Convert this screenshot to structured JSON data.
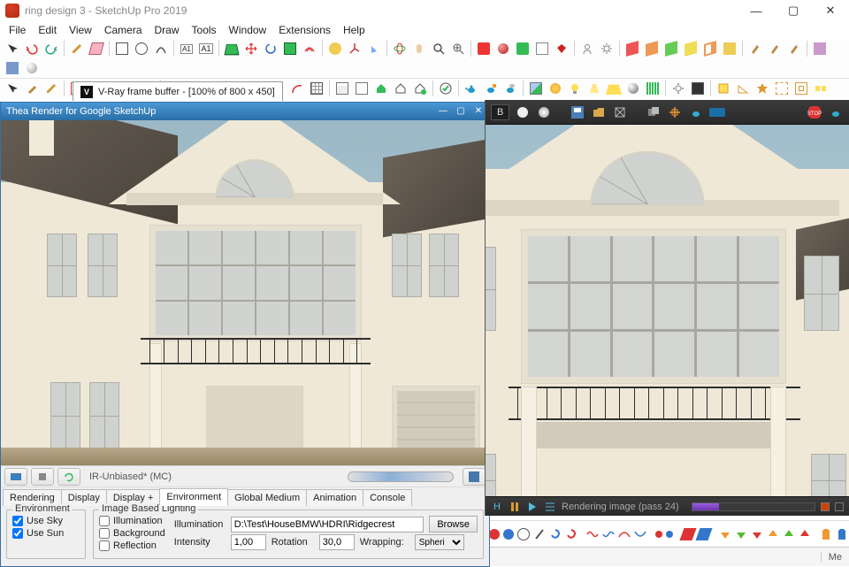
{
  "titlebar": {
    "title": "ring design 3 - SketchUp Pro 2019"
  },
  "menu": {
    "items": [
      "File",
      "Edit",
      "View",
      "Camera",
      "Draw",
      "Tools",
      "Window",
      "Extensions",
      "Help"
    ]
  },
  "vfb_tab": {
    "label": "V-Ray frame buffer - [100% of 800 x 450]"
  },
  "thea": {
    "title": "Thea Render for Google SketchUp",
    "engine": "IR-Unbiased* (MC)",
    "tabs": [
      "Rendering",
      "Display",
      "Display +",
      "Environment",
      "Global Medium",
      "Animation",
      "Console"
    ],
    "active_tab": "Environment",
    "env": {
      "use_sky": true,
      "use_sun": true
    },
    "ibl": {
      "illumination": false,
      "background": false,
      "reflection": false,
      "illum_label": "Illumination",
      "illum_path": "D:\\Test\\HouseBMW\\HDRI\\Ridgecrest",
      "browse": "Browse",
      "intensity_label": "Intensity",
      "intensity": "1,00",
      "rotation_label": "Rotation",
      "rotation": "30,0",
      "wrapping_label": "Wrapping:",
      "wrapping": "Spheri"
    }
  },
  "vray": {
    "channel": "B",
    "status_text": "Rendering image (pass 24)"
  },
  "status": {
    "label": "Me"
  }
}
